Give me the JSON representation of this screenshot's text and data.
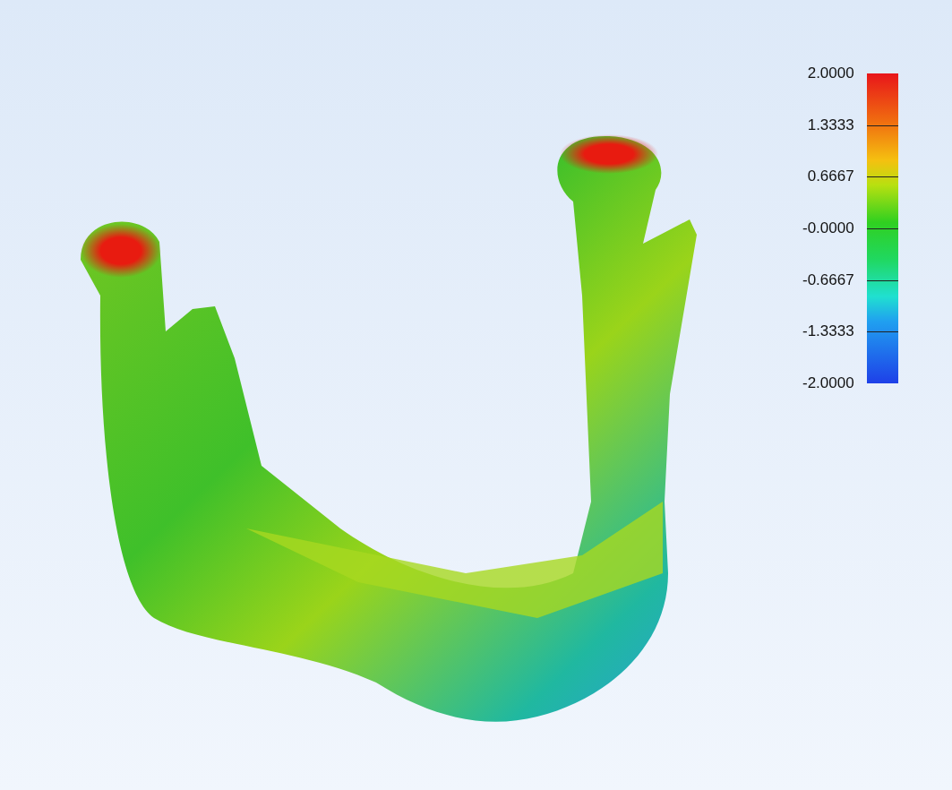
{
  "color_scale": {
    "labels": [
      "2.0000",
      "1.3333",
      "0.6667",
      "-0.0000",
      "-0.6667",
      "-1.3333",
      "-2.0000"
    ]
  }
}
